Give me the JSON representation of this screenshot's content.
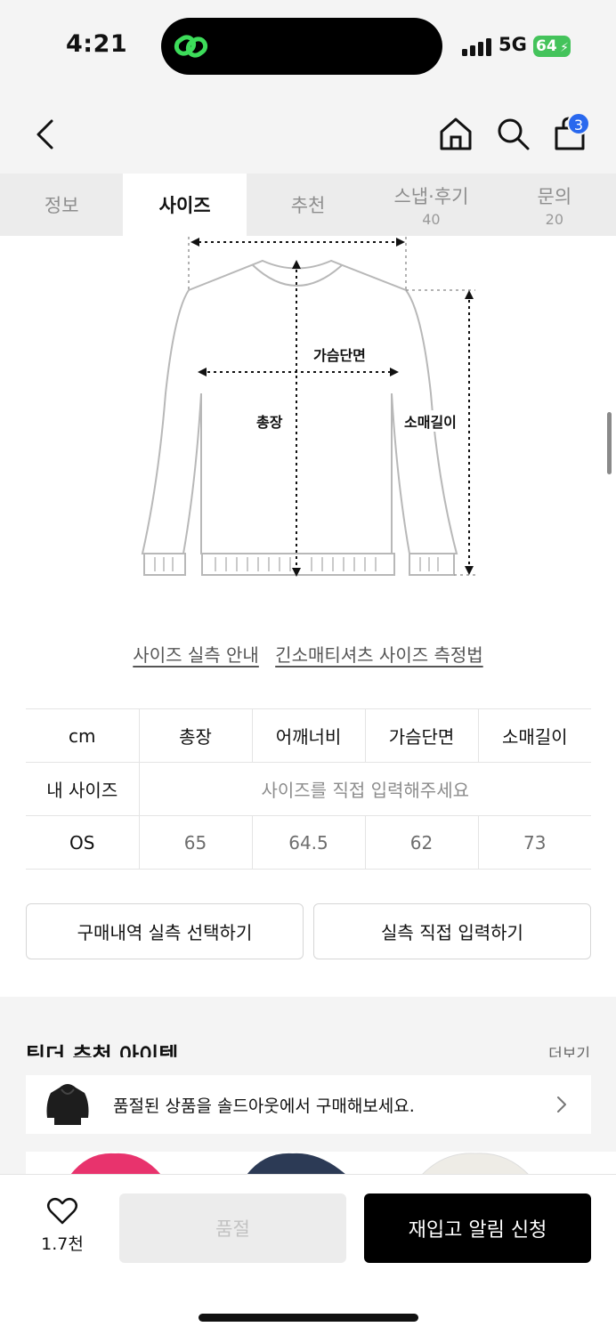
{
  "status_bar": {
    "time": "4:21",
    "network": "5G",
    "battery": "64"
  },
  "nav": {
    "cart_count": "3"
  },
  "tabs": [
    {
      "label": "정보",
      "count": ""
    },
    {
      "label": "사이즈",
      "count": ""
    },
    {
      "label": "추천",
      "count": ""
    },
    {
      "label": "스냅·후기",
      "count": "40"
    },
    {
      "label": "문의",
      "count": "20"
    }
  ],
  "diagram": {
    "chest_label": "가슴단면",
    "length_label": "총장",
    "sleeve_label": "소매길이"
  },
  "guide_links": {
    "size_guide": "사이즈 실측 안내",
    "measure_method": "긴소매티셔츠 사이즈 측정법"
  },
  "size_table": {
    "headers": [
      "cm",
      "총장",
      "어깨너비",
      "가슴단면",
      "소매길이"
    ],
    "my_size_label": "내 사이즈",
    "my_size_placeholder": "사이즈를 직접 입력해주세요",
    "rows": [
      {
        "size": "OS",
        "values": [
          "65",
          "64.5",
          "62",
          "73"
        ]
      }
    ]
  },
  "buttons": {
    "select_purchase": "구매내역 실측 선택하기",
    "manual_input": "실측 직접 입력하기"
  },
  "recommend": {
    "title": "팀더 추천 아이템",
    "more": "더보기"
  },
  "soldout_banner": {
    "text": "품절된 상품을 솔드아웃에서 구매해보세요."
  },
  "bottom": {
    "like_count": "1.7천",
    "soldout_label": "품절",
    "restock_label": "재입고 알림 신청"
  },
  "colors": {
    "accent_blue": "#2968ee",
    "battery_green": "#44c35b",
    "black": "#000000"
  }
}
